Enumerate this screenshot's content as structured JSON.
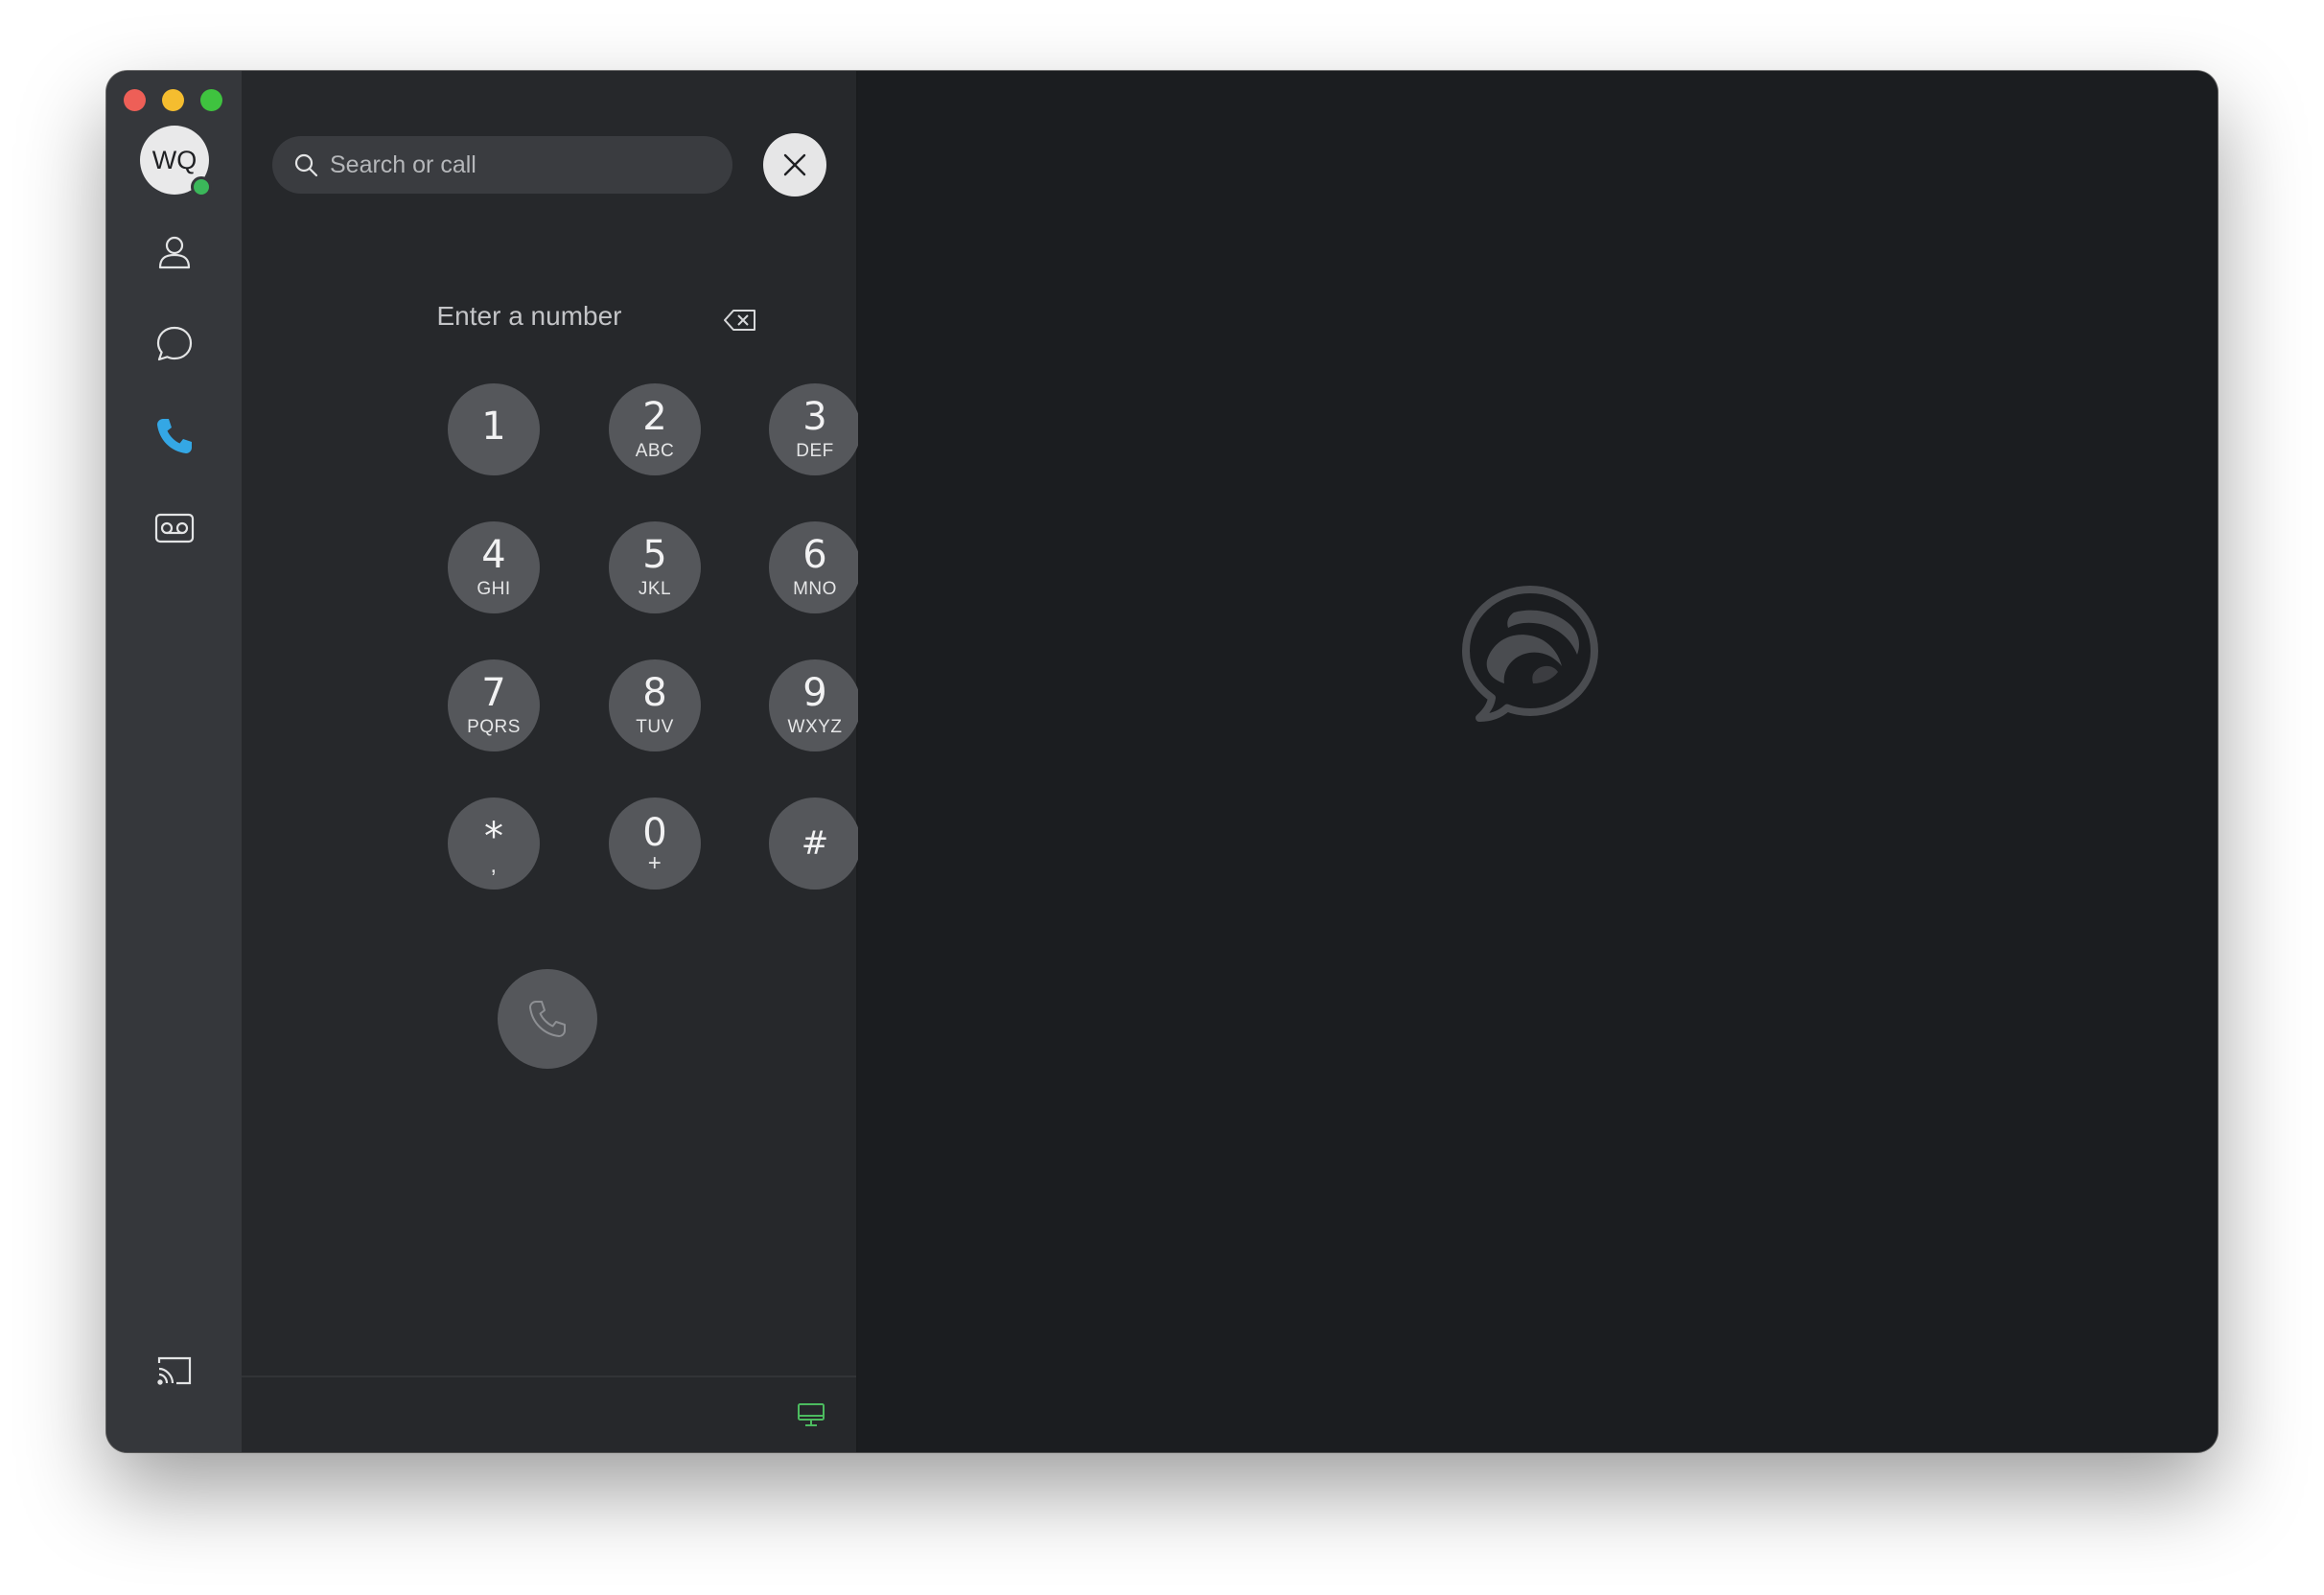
{
  "window": {
    "traffic_lights": {
      "close": "#ee5f57",
      "minimize": "#f5bd2f",
      "maximize": "#3fc33f"
    }
  },
  "sidebar": {
    "avatar_initials": "WQ",
    "presence_color": "#3bb75a",
    "items": [
      {
        "icon": "person-icon",
        "label": "Contacts"
      },
      {
        "icon": "chat-bubble-icon",
        "label": "Messaging"
      },
      {
        "icon": "phone-icon",
        "label": "Calling",
        "active": true,
        "color": "#34a7e5"
      },
      {
        "icon": "voicemail-icon",
        "label": "Voicemail"
      }
    ],
    "bottom_icon": "screen-cast-icon"
  },
  "search": {
    "placeholder": "Search or call",
    "icon": "search-icon"
  },
  "dialer": {
    "number_placeholder": "Enter a number",
    "keys": [
      {
        "digit": "1",
        "letters": ""
      },
      {
        "digit": "2",
        "letters": "ABC"
      },
      {
        "digit": "3",
        "letters": "DEF"
      },
      {
        "digit": "4",
        "letters": "GHI"
      },
      {
        "digit": "5",
        "letters": "JKL"
      },
      {
        "digit": "6",
        "letters": "MNO"
      },
      {
        "digit": "7",
        "letters": "PQRS"
      },
      {
        "digit": "8",
        "letters": "TUV"
      },
      {
        "digit": "9",
        "letters": "WXYZ"
      },
      {
        "digit": "*",
        "letters": ","
      },
      {
        "digit": "0",
        "letters": "+"
      },
      {
        "digit": "#",
        "letters": ""
      }
    ],
    "call_icon": "phone-icon"
  },
  "footer": {
    "device_icon": "monitor-icon",
    "device_color": "#4cbb5f"
  },
  "main": {
    "logo": "webex-logo"
  }
}
